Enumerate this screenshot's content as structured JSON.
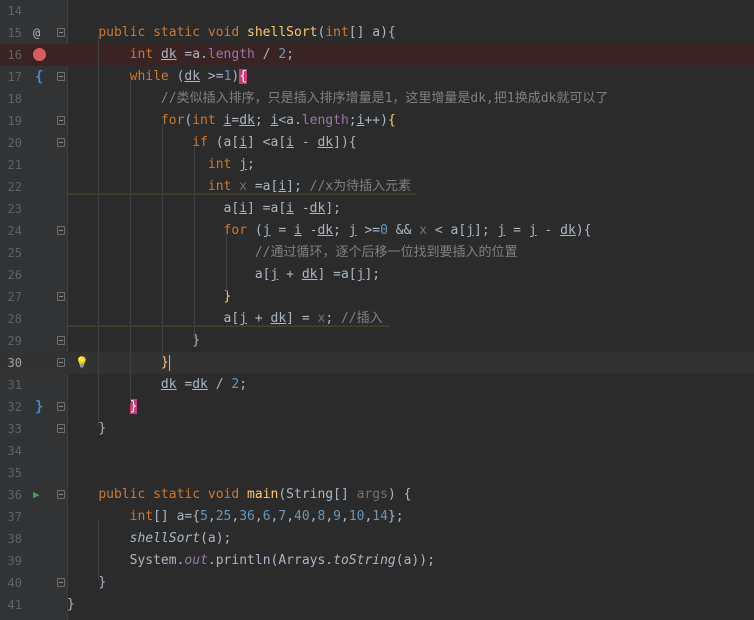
{
  "lines": [
    {
      "n": "14",
      "segs": []
    },
    {
      "n": "15",
      "segs": [
        [
          "pad",
          "    "
        ],
        [
          "kw",
          "public static void "
        ],
        [
          "fn",
          "shellSort"
        ],
        [
          "p",
          "("
        ],
        [
          "kw",
          "int"
        ],
        [
          "p",
          "[] "
        ],
        [
          "prm",
          "a"
        ],
        [
          "p",
          "){"
        ]
      ]
    },
    {
      "n": "16",
      "segs": [
        [
          "pad",
          "        "
        ],
        [
          "kw",
          "int "
        ],
        [
          "v",
          "dk"
        ],
        [
          "p",
          " =a."
        ],
        [
          "fld",
          "length"
        ],
        [
          "p",
          " / "
        ],
        [
          "num",
          "2"
        ],
        [
          "p",
          ";"
        ]
      ]
    },
    {
      "n": "17",
      "segs": [
        [
          "pad",
          "        "
        ],
        [
          "kw",
          "while "
        ],
        [
          "p",
          "("
        ],
        [
          "v",
          "dk"
        ],
        [
          "p",
          " >="
        ],
        [
          "num",
          "1"
        ],
        [
          "p",
          ")"
        ],
        [
          "hl",
          "{"
        ]
      ]
    },
    {
      "n": "18",
      "segs": [
        [
          "pad",
          "            "
        ],
        [
          "cmt",
          "//类似插入排序，只是插入排序增量是1，这里增量是dk,把1换成dk就可以了"
        ]
      ]
    },
    {
      "n": "19",
      "segs": [
        [
          "pad",
          "            "
        ],
        [
          "kw",
          "for"
        ],
        [
          "p",
          "("
        ],
        [
          "kw",
          "int "
        ],
        [
          "v",
          "i"
        ],
        [
          "p",
          "="
        ],
        [
          "v",
          "dk"
        ],
        [
          "p",
          "; "
        ],
        [
          "v",
          "i"
        ],
        [
          "p",
          "<a."
        ],
        [
          "fld",
          "length"
        ],
        [
          "p",
          ";"
        ],
        [
          "v",
          "i"
        ],
        [
          "p",
          "++)"
        ],
        [
          "fn",
          "{"
        ]
      ]
    },
    {
      "n": "20",
      "segs": [
        [
          "pad",
          "                "
        ],
        [
          "kw",
          "if "
        ],
        [
          "p",
          "(a["
        ],
        [
          "v",
          "i"
        ],
        [
          "p",
          "] <a["
        ],
        [
          "v",
          "i"
        ],
        [
          "p",
          " - "
        ],
        [
          "v",
          "dk"
        ],
        [
          "p",
          "]){"
        ]
      ]
    },
    {
      "n": "21",
      "segs": [
        [
          "pad",
          "                  "
        ],
        [
          "kw",
          "int "
        ],
        [
          "v",
          "j"
        ],
        [
          "p",
          ";"
        ]
      ]
    },
    {
      "n": "22",
      "segs": [
        [
          "pad",
          "                  "
        ],
        [
          "kw",
          "int "
        ],
        [
          "g",
          "x"
        ],
        [
          "p",
          " =a["
        ],
        [
          "v",
          "i"
        ],
        [
          "p",
          "]; "
        ],
        [
          "cmt",
          "//x为待插入元素"
        ]
      ]
    },
    {
      "n": "23",
      "segs": [
        [
          "pad",
          "                    "
        ],
        [
          "p",
          "a["
        ],
        [
          "v",
          "i"
        ],
        [
          "p",
          "] =a["
        ],
        [
          "v",
          "i"
        ],
        [
          "p",
          " -"
        ],
        [
          "v",
          "dk"
        ],
        [
          "p",
          "];"
        ]
      ]
    },
    {
      "n": "24",
      "segs": [
        [
          "pad",
          "                    "
        ],
        [
          "kw",
          "for "
        ],
        [
          "p",
          "("
        ],
        [
          "v",
          "j"
        ],
        [
          "p",
          " = "
        ],
        [
          "v",
          "i"
        ],
        [
          "p",
          " -"
        ],
        [
          "v",
          "dk"
        ],
        [
          "p",
          "; "
        ],
        [
          "v",
          "j"
        ],
        [
          "p",
          " >="
        ],
        [
          "num",
          "0"
        ],
        [
          "p",
          " && "
        ],
        [
          "g",
          "x"
        ],
        [
          "p",
          " < a["
        ],
        [
          "v",
          "j"
        ],
        [
          "p",
          "]; "
        ],
        [
          "v",
          "j"
        ],
        [
          "p",
          " = "
        ],
        [
          "v",
          "j"
        ],
        [
          "p",
          " - "
        ],
        [
          "v",
          "dk"
        ],
        [
          "p",
          "){"
        ]
      ]
    },
    {
      "n": "25",
      "segs": [
        [
          "pad",
          "                        "
        ],
        [
          "cmt",
          "//通过循环，逐个后移一位找到要插入的位置"
        ]
      ]
    },
    {
      "n": "26",
      "segs": [
        [
          "pad",
          "                        "
        ],
        [
          "p",
          "a["
        ],
        [
          "v",
          "j"
        ],
        [
          "p",
          " + "
        ],
        [
          "v",
          "dk"
        ],
        [
          "p",
          "] =a["
        ],
        [
          "v",
          "j"
        ],
        [
          "p",
          "];"
        ]
      ]
    },
    {
      "n": "27",
      "segs": [
        [
          "pad",
          "                    "
        ],
        [
          "fn",
          "}"
        ]
      ]
    },
    {
      "n": "28",
      "segs": [
        [
          "pad",
          "                    "
        ],
        [
          "p",
          "a["
        ],
        [
          "v",
          "j"
        ],
        [
          "p",
          " + "
        ],
        [
          "v",
          "dk"
        ],
        [
          "p",
          "] = "
        ],
        [
          "g",
          "x"
        ],
        [
          "p",
          "; "
        ],
        [
          "cmt",
          "//插入"
        ]
      ]
    },
    {
      "n": "29",
      "segs": [
        [
          "pad",
          "                "
        ],
        [
          "p",
          "}"
        ]
      ]
    },
    {
      "n": "30",
      "segs": [
        [
          "pad",
          "            "
        ],
        [
          "fn",
          "}"
        ],
        [
          "caret",
          ""
        ]
      ]
    },
    {
      "n": "31",
      "segs": [
        [
          "pad",
          "            "
        ],
        [
          "v",
          "dk"
        ],
        [
          "p",
          " ="
        ],
        [
          "v",
          "dk"
        ],
        [
          "p",
          " / "
        ],
        [
          "num",
          "2"
        ],
        [
          "p",
          ";"
        ]
      ]
    },
    {
      "n": "32",
      "segs": [
        [
          "pad",
          "        "
        ],
        [
          "hl",
          "}"
        ]
      ]
    },
    {
      "n": "33",
      "segs": [
        [
          "pad",
          "    "
        ],
        [
          "p",
          "}"
        ]
      ]
    },
    {
      "n": "34",
      "segs": []
    },
    {
      "n": "35",
      "segs": []
    },
    {
      "n": "36",
      "segs": [
        [
          "pad",
          "    "
        ],
        [
          "kw",
          "public static void "
        ],
        [
          "fn",
          "main"
        ],
        [
          "p",
          "(String[] "
        ],
        [
          "g",
          "args"
        ],
        [
          "p",
          ") {"
        ]
      ]
    },
    {
      "n": "37",
      "segs": [
        [
          "pad",
          "        "
        ],
        [
          "kw",
          "int"
        ],
        [
          "p",
          "[] a={"
        ],
        [
          "num",
          "5"
        ],
        [
          "p",
          ","
        ],
        [
          "num",
          "25"
        ],
        [
          "p",
          ","
        ],
        [
          "num",
          "36"
        ],
        [
          "p",
          ","
        ],
        [
          "num",
          "6"
        ],
        [
          "p",
          ","
        ],
        [
          "num",
          "7"
        ],
        [
          "p",
          ","
        ],
        [
          "num",
          "40"
        ],
        [
          "p",
          ","
        ],
        [
          "num",
          "8"
        ],
        [
          "p",
          ","
        ],
        [
          "num",
          "9"
        ],
        [
          "p",
          ","
        ],
        [
          "num",
          "10"
        ],
        [
          "p",
          ","
        ],
        [
          "num",
          "14"
        ],
        [
          "p",
          "};"
        ]
      ]
    },
    {
      "n": "38",
      "segs": [
        [
          "pad",
          "        "
        ],
        [
          "it",
          "shellSort"
        ],
        [
          "p",
          "(a);"
        ]
      ]
    },
    {
      "n": "39",
      "segs": [
        [
          "pad",
          "        "
        ],
        [
          "p",
          "System."
        ],
        [
          "fldi",
          "out"
        ],
        [
          "p",
          ".println(Arrays."
        ],
        [
          "it",
          "toString"
        ],
        [
          "p",
          "(a));"
        ]
      ]
    },
    {
      "n": "40",
      "segs": [
        [
          "pad",
          "    "
        ],
        [
          "p",
          "}"
        ]
      ]
    },
    {
      "n": "41",
      "segs": [
        [
          "p",
          "}"
        ]
      ]
    }
  ],
  "gutter": {
    "override_icon": "@",
    "breakpoint_icon": "breakpoint-dot-icon",
    "run_icon": "▶",
    "bulb_icon": "💡",
    "brace_open": "{",
    "brace_close": "}",
    "current_line": "30"
  },
  "colors": {
    "background": "#2b2b2b",
    "keyword": "#cc7832",
    "function": "#ffc66d",
    "number": "#6897bb",
    "comment": "#808080",
    "field": "#9876aa",
    "brace_highlight": "#cc3a78"
  }
}
